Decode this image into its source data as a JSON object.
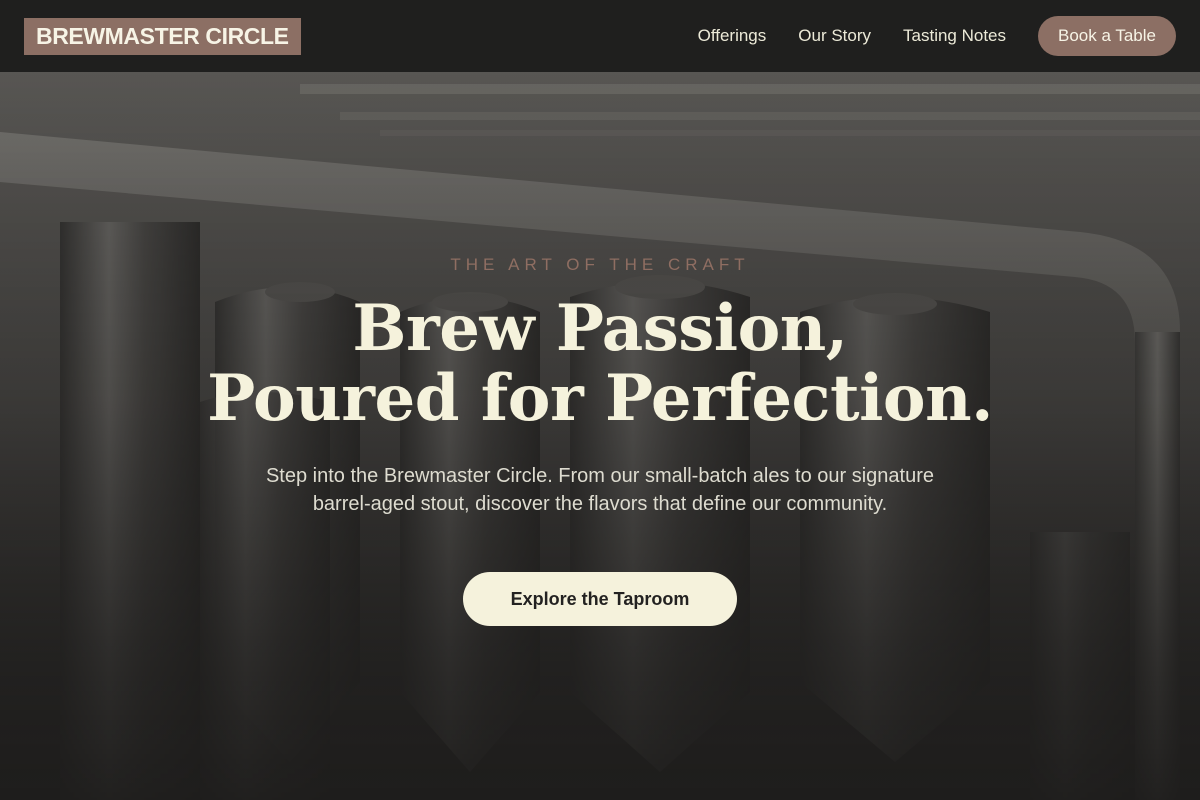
{
  "brand": {
    "name": "BREWMASTER CIRCLE"
  },
  "nav": {
    "links": [
      "Offerings",
      "Our Story",
      "Tasting Notes"
    ],
    "cta": "Book a Table"
  },
  "hero": {
    "eyebrow": "THE ART OF THE CRAFT",
    "headline_line1": "Brew Passion,",
    "headline_line2": "Poured for Perfection.",
    "lede": "Step into the Brewmaster Circle. From our small-batch ales to our signature barrel-aged stout, discover the flavors that define our community.",
    "cta": "Explore the Taproom"
  },
  "colors": {
    "header_bg": "#1f1f1e",
    "accent": "#8c6f64",
    "cream": "#f5f2dc",
    "eyebrow": "#8f6e62"
  },
  "icons": []
}
